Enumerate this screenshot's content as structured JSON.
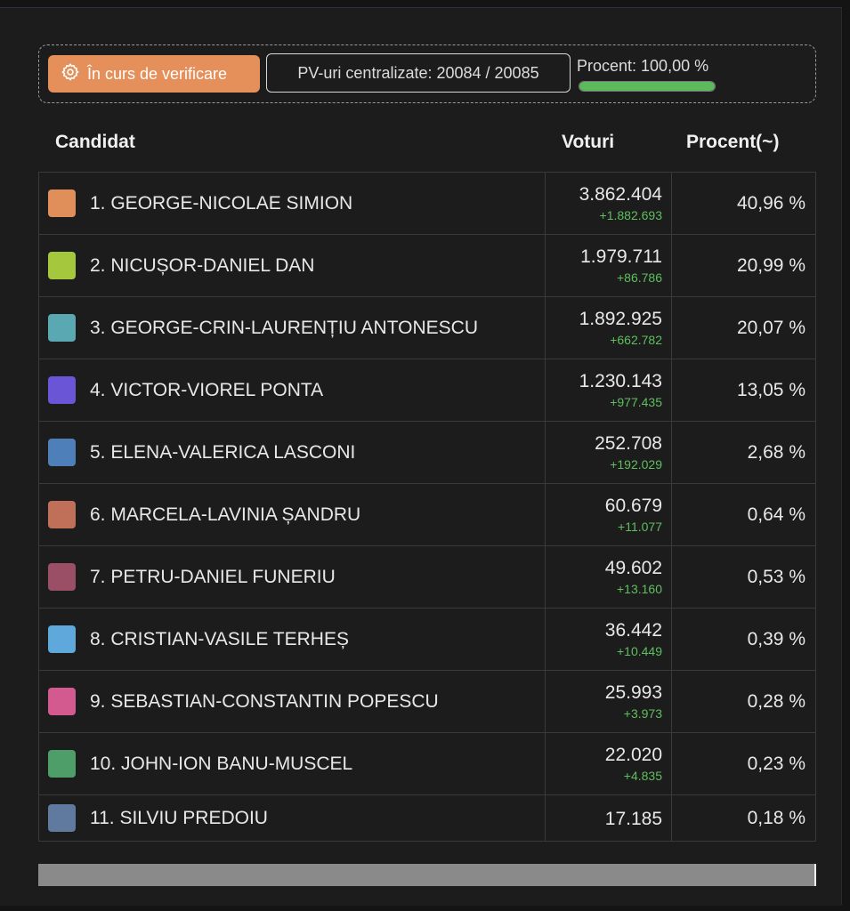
{
  "status": {
    "button_label": "În curs de verificare",
    "button_icon": "gear-icon",
    "pv_text": "PV-uri centralizate: 20084 / 20085",
    "procent_label": "Procent: 100,00 %",
    "progress_percent": 100,
    "colors": {
      "button": "#e58f5a",
      "progress": "#5cba5c"
    }
  },
  "table": {
    "headers": {
      "candidate": "Candidat",
      "votes": "Voturi",
      "percent": "Procent(~)"
    },
    "rows": [
      {
        "name": "1. GEORGE-NICOLAE SIMION",
        "votes": "3.862.404",
        "delta": "+1.882.693",
        "percent": "40,96 %",
        "color": "#e08f5a"
      },
      {
        "name": "2. NICUȘOR-DANIEL DAN",
        "votes": "1.979.711",
        "delta": "+86.786",
        "percent": "20,99 %",
        "color": "#a4c73e"
      },
      {
        "name": "3. GEORGE-CRIN-LAURENȚIU ANTONESCU",
        "votes": "1.892.925",
        "delta": "+662.782",
        "percent": "20,07 %",
        "color": "#5aa8b2"
      },
      {
        "name": "4. VICTOR-VIOREL PONTA",
        "votes": "1.230.143",
        "delta": "+977.435",
        "percent": "13,05 %",
        "color": "#6a55d6"
      },
      {
        "name": "5. ELENA-VALERICA LASCONI",
        "votes": "252.708",
        "delta": "+192.029",
        "percent": "2,68 %",
        "color": "#4f7fb8"
      },
      {
        "name": "6. MARCELA-LAVINIA ȘANDRU",
        "votes": "60.679",
        "delta": "+11.077",
        "percent": "0,64 %",
        "color": "#c07058"
      },
      {
        "name": "7. PETRU-DANIEL FUNERIU",
        "votes": "49.602",
        "delta": "+13.160",
        "percent": "0,53 %",
        "color": "#9a4f66"
      },
      {
        "name": "8. CRISTIAN-VASILE TERHEȘ",
        "votes": "36.442",
        "delta": "+10.449",
        "percent": "0,39 %",
        "color": "#5ea8dc"
      },
      {
        "name": "9. SEBASTIAN-CONSTANTIN POPESCU",
        "votes": "25.993",
        "delta": "+3.973",
        "percent": "0,28 %",
        "color": "#d25a8e"
      },
      {
        "name": "10. JOHN-ION BANU-MUSCEL",
        "votes": "22.020",
        "delta": "+4.835",
        "percent": "0,23 %",
        "color": "#4e9e6a"
      },
      {
        "name": "11. SILVIU PREDOIU",
        "votes": "17.185",
        "delta": "",
        "percent": "0,18 %",
        "color": "#5f7a9e"
      }
    ]
  }
}
